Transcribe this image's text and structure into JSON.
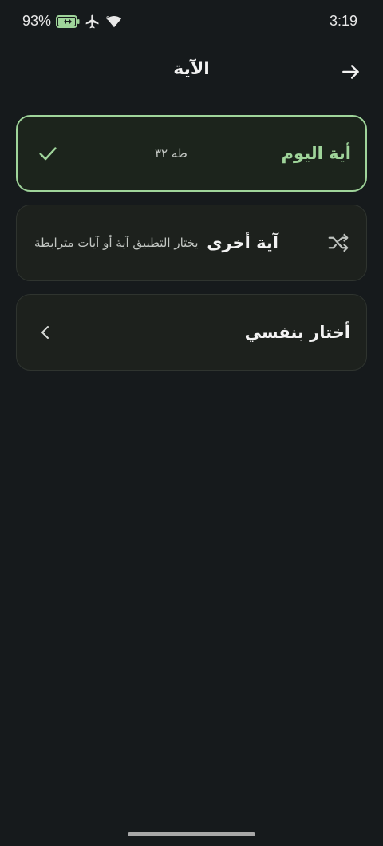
{
  "status_bar": {
    "battery": "93%",
    "time": "3:19"
  },
  "header": {
    "title": "الآية"
  },
  "options": {
    "verse_of_day": {
      "title": "أية اليوم",
      "reference": "طه ٣٢"
    },
    "another_verse": {
      "title": "آية أخرى",
      "description": "يختار التطبيق آية أو آيات مترابطة"
    },
    "choose_myself": {
      "title": "أختار بنفسي"
    }
  },
  "colors": {
    "background": "#161a1c",
    "accent": "#9fd49a",
    "card": "#1d211d"
  }
}
